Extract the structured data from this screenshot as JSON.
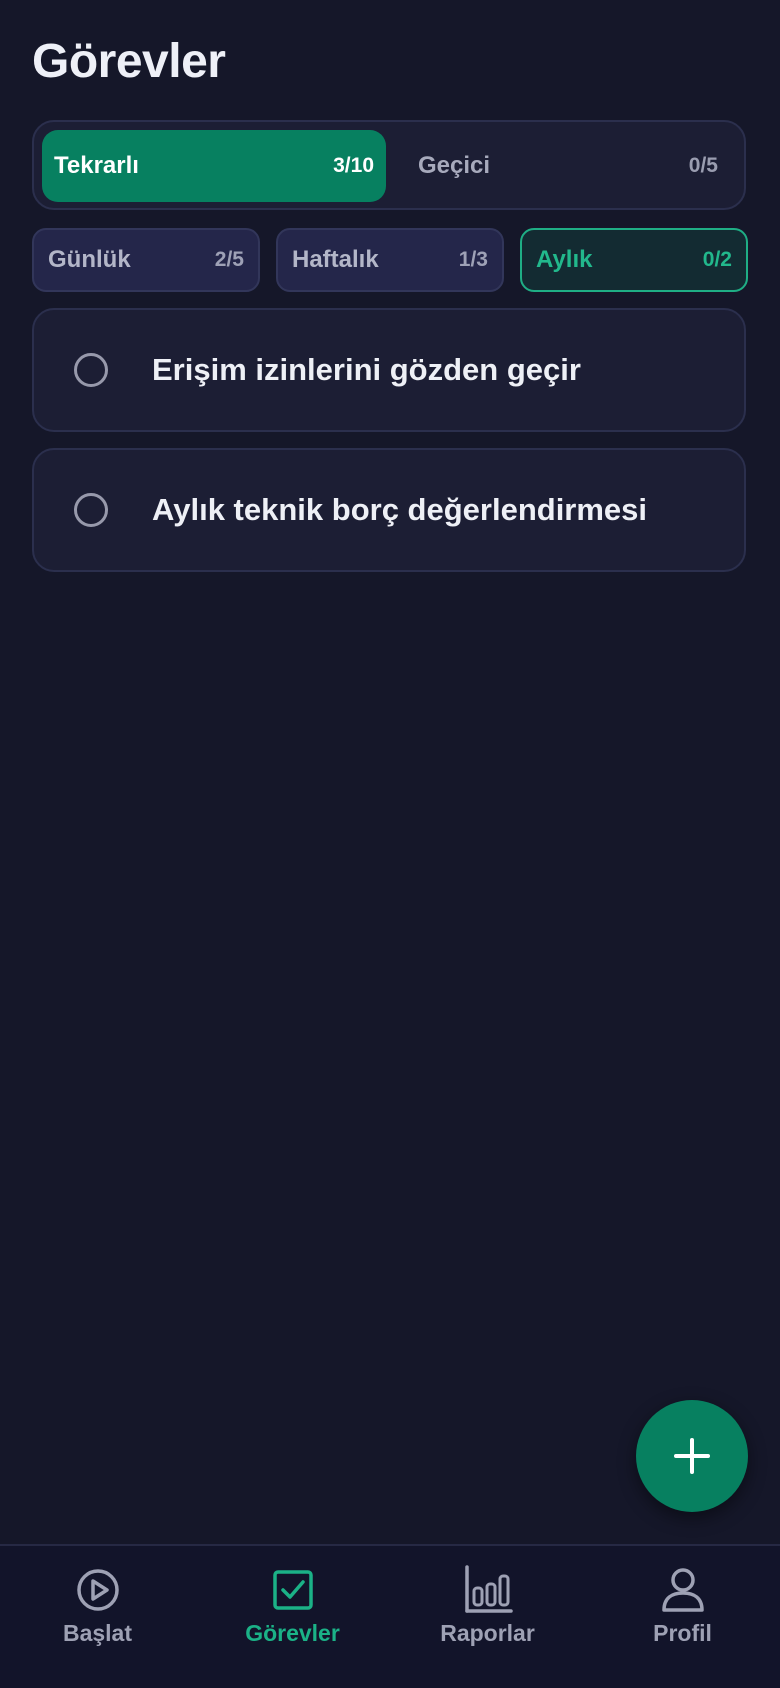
{
  "page": {
    "title": "Görevler"
  },
  "segments": [
    {
      "label": "Tekrarlı",
      "count": "3/10",
      "active": true
    },
    {
      "label": "Geçici",
      "count": "0/5",
      "active": false
    }
  ],
  "periods": [
    {
      "label": "Günlük",
      "count": "2/5",
      "active": false
    },
    {
      "label": "Haftalık",
      "count": "1/3",
      "active": false
    },
    {
      "label": "Aylık",
      "count": "0/2",
      "active": true
    }
  ],
  "tasks": [
    {
      "text": "Erişim izinlerini gözden geçir",
      "done": false
    },
    {
      "text": "Aylık teknik borç değerlendirmesi",
      "done": false
    }
  ],
  "fab": {
    "icon": "plus-icon"
  },
  "nav": {
    "items": [
      {
        "label": "Başlat",
        "icon": "play-circle-icon",
        "active": false
      },
      {
        "label": "Görevler",
        "icon": "checkbox-icon",
        "active": true
      },
      {
        "label": "Raporlar",
        "icon": "bar-chart-icon",
        "active": false
      },
      {
        "label": "Profil",
        "icon": "user-icon",
        "active": false
      }
    ]
  },
  "colors": {
    "background": "#151729",
    "accent": "#078060",
    "accent_text": "#1bb287",
    "card": "#1c1e34"
  }
}
